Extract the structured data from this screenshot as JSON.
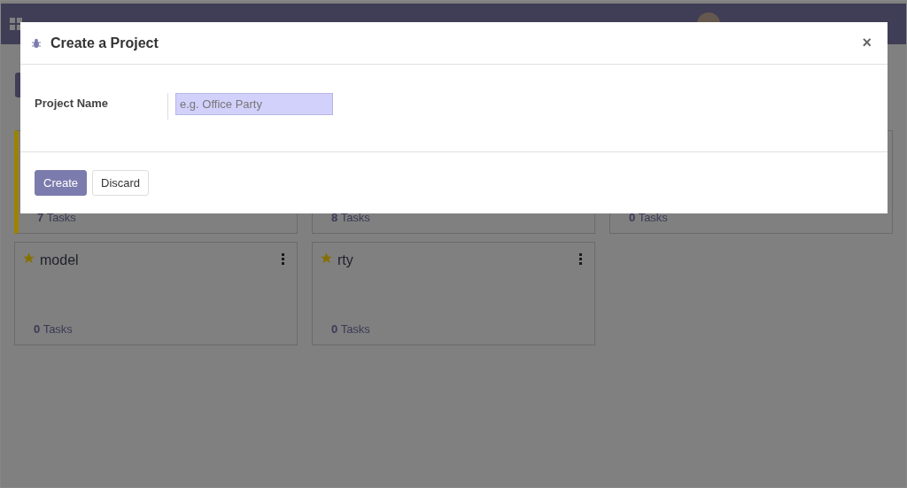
{
  "projects": [
    {
      "color": "#9c8400",
      "task_count": "7",
      "tasks_label": "Tasks"
    },
    {
      "task_count": "8",
      "tasks_label": "Tasks"
    },
    {
      "task_count": "0",
      "tasks_label": "Tasks"
    },
    {
      "name": "model",
      "starred": true,
      "task_count": "0",
      "tasks_label": "Tasks"
    },
    {
      "name": "rty",
      "starred": true,
      "task_count": "0",
      "tasks_label": "Tasks"
    }
  ],
  "dialog": {
    "title": "Create a Project",
    "close": "×",
    "field": {
      "label": "Project Name",
      "placeholder": "e.g. Office Party",
      "focused": true
    },
    "buttons": [
      {
        "label": "Create",
        "kind": "primary"
      },
      {
        "label": "Discard",
        "kind": "secondary"
      }
    ]
  }
}
